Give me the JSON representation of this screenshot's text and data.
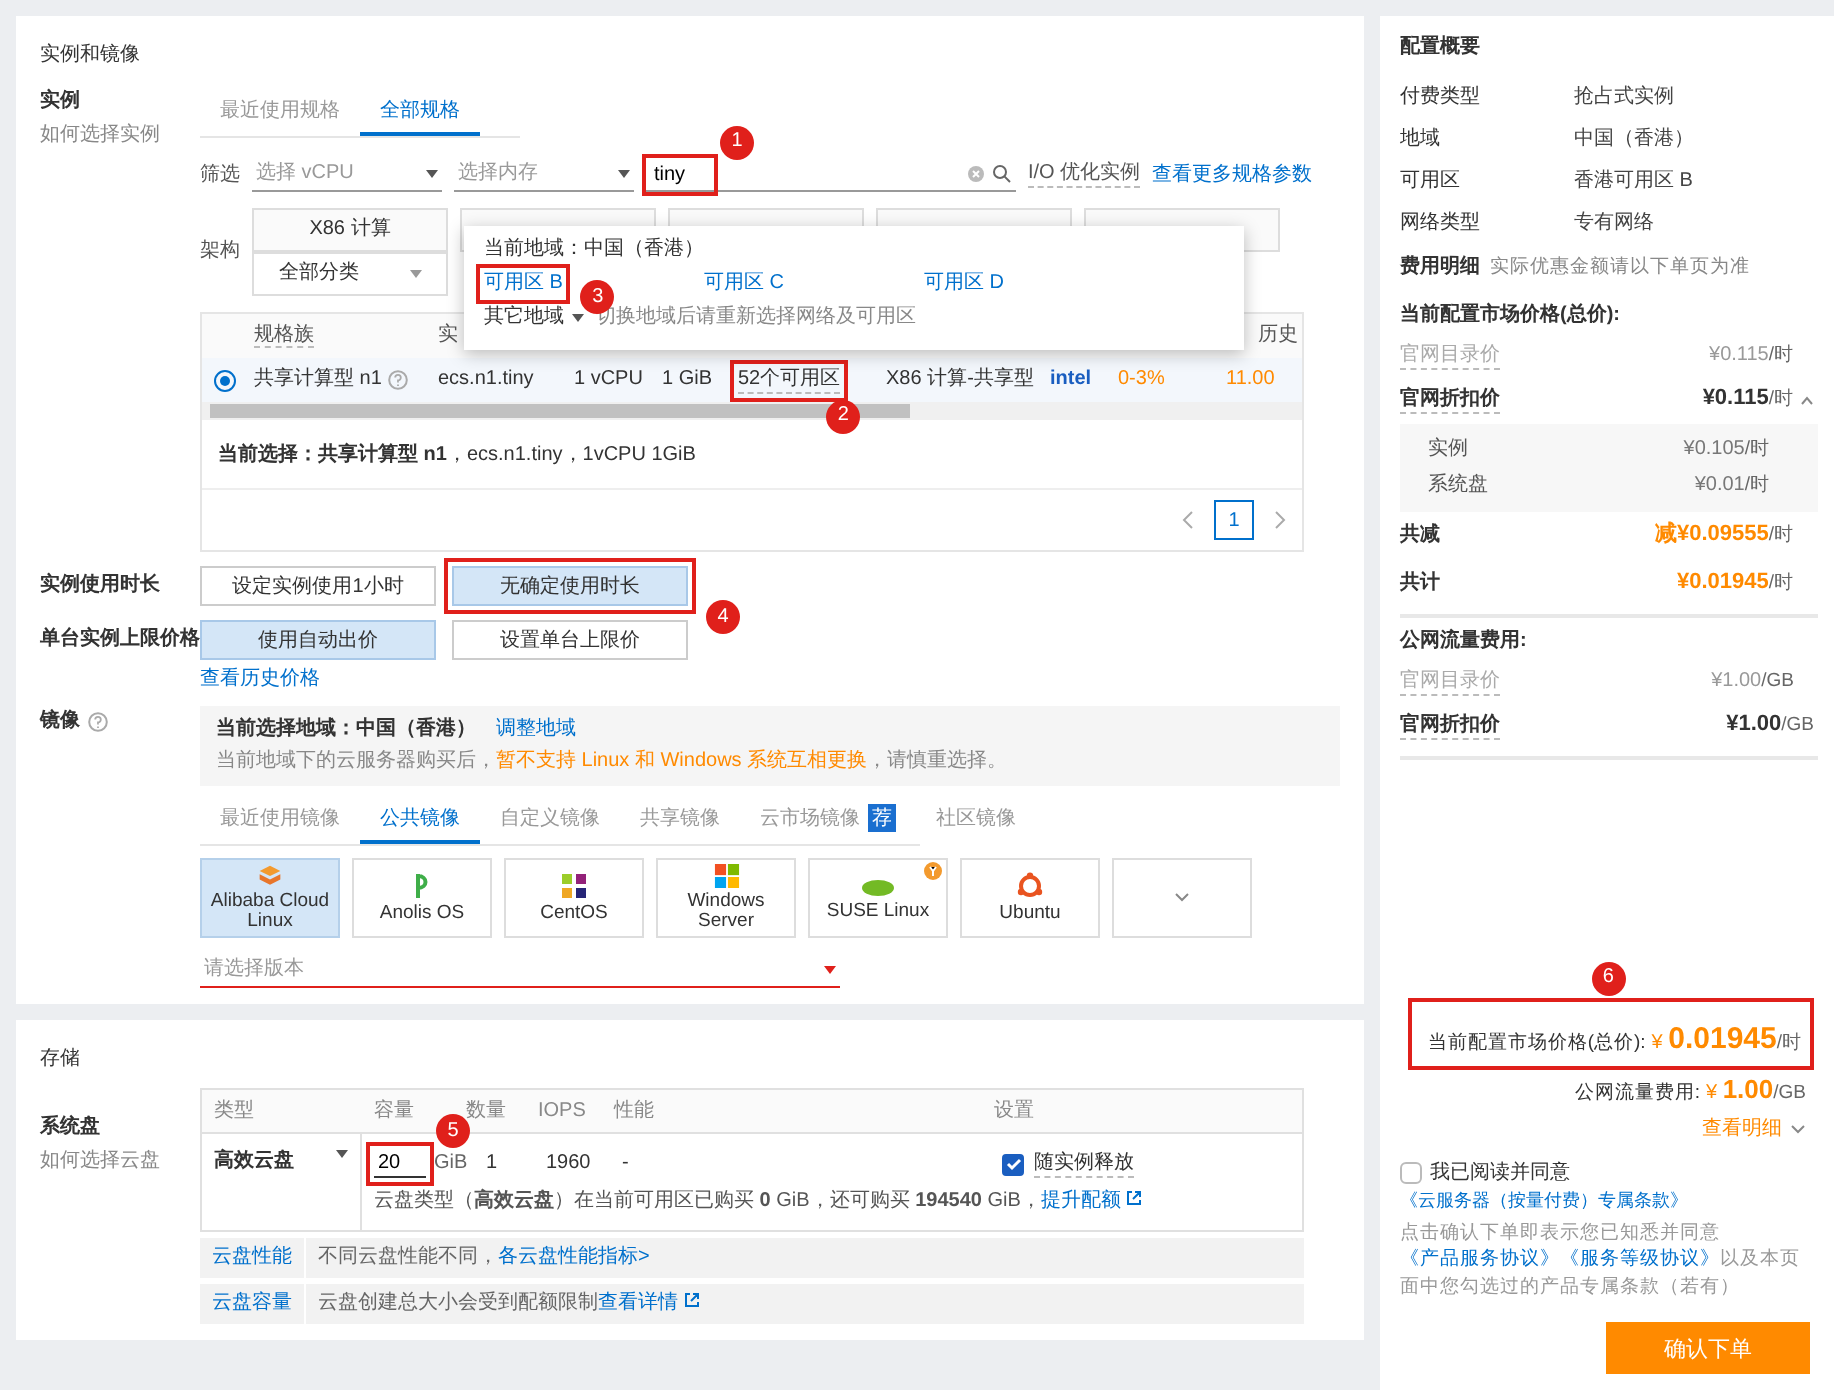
{
  "instance_section": {
    "title": "实例和镜像",
    "instance": {
      "label": "实例",
      "help": "如何选择实例",
      "tabs": [
        {
          "label": "最近使用规格",
          "selected": false
        },
        {
          "label": "全部规格",
          "selected": true
        }
      ],
      "filter": {
        "label": "筛选",
        "vcpu_placeholder": "选择 vCPU",
        "memory_placeholder": "选择内存",
        "search_value": "tiny",
        "search_marker": "1",
        "io_label": "I/O 优化实例",
        "more_link": "查看更多规格参数"
      },
      "arch": {
        "label": "架构",
        "first_tile": "X86 计算",
        "category": "全部分类"
      },
      "zone_popup": {
        "current": "当前地域：中国（香港）",
        "zones": [
          {
            "label": "可用区 B",
            "marker": "3"
          },
          {
            "label": "可用区 C"
          },
          {
            "label": "可用区 D"
          }
        ],
        "other": "其它地域",
        "other_hint": "切换地域后请重新选择网络及可用区"
      },
      "table": {
        "columns": [
          {
            "label": "规格族"
          },
          {
            "label": "实"
          },
          {
            "label": "历史"
          }
        ],
        "rows": [
          {
            "selected": true,
            "family": "共享计算型 n1",
            "spec": "ecs.n1.tiny",
            "vcpu": "1 vCPU",
            "memory": "1 GiB",
            "zones": "52个可用区",
            "zones_marker": "2",
            "arch": "X86 计算-共享型",
            "brand": "intel",
            "performance": "0-3%",
            "price": "11.00"
          }
        ]
      },
      "current_selection": "**当前选择：共享计算型 n1**，ecs.n1.tiny，1vCPU 1GiB",
      "pagination": {
        "page": "1"
      }
    },
    "duration": {
      "label": "实例使用时长",
      "options": [
        {
          "label": "设定实例使用1小时",
          "selected": false
        },
        {
          "label": "无确定使用时长",
          "selected": true,
          "marker": "4"
        }
      ]
    },
    "price_limit": {
      "label": "单台实例上限价格",
      "options": [
        {
          "label": "使用自动出价",
          "selected": true
        },
        {
          "label": "设置单台上限价",
          "selected": false
        }
      ],
      "history_link": "查看历史价格"
    },
    "image": {
      "label": "镜像",
      "region_text": "当前选择地域：中国（香港）",
      "adjust_link": "调整地域",
      "notice": "当前地域下的云服务器购买后，",
      "notice_warn": "暂不支持 Linux 和 Windows 系统互相更换",
      "notice_end": "，请慎重选择。",
      "tabs": [
        {
          "label": "最近使用镜像",
          "selected": false
        },
        {
          "label": "公共镜像",
          "selected": true
        },
        {
          "label": "自定义镜像",
          "selected": false
        },
        {
          "label": "共享镜像",
          "selected": false
        },
        {
          "label": "云市场镜像",
          "selected": false,
          "badge": "荐"
        },
        {
          "label": "社区镜像",
          "selected": false
        }
      ],
      "os": [
        {
          "kind": "alibaba",
          "label": "Alibaba Cloud Linux",
          "selected": true
        },
        {
          "kind": "anolis",
          "label": "Anolis OS",
          "selected": false
        },
        {
          "kind": "centos",
          "label": "CentOS",
          "selected": false
        },
        {
          "kind": "windows",
          "label": "Windows Server",
          "selected": false
        },
        {
          "kind": "suse",
          "label": "SUSE Linux",
          "selected": false
        },
        {
          "kind": "ubuntu",
          "label": "Ubuntu",
          "selected": false
        },
        {
          "kind": "more",
          "selected": false
        }
      ],
      "version_placeholder": "请选择版本"
    }
  },
  "storage": {
    "title": "存储",
    "label": "系统盘",
    "help": "如何选择云盘",
    "columns": [
      "类型",
      "容量",
      "数量",
      "IOPS",
      "性能",
      "设置"
    ],
    "disk": {
      "type": "高效云盘",
      "capacity": "20",
      "capacity_marker": "5",
      "unit": "GiB",
      "count": "1",
      "iops": "1960",
      "performance": "-",
      "release_checked": true,
      "release_label": "随实例释放",
      "quota_note": "云盘类型（**高效云盘**）在当前可用区已购买 **0** GiB，还可购买 **194540** GiB，",
      "quota_link": "提升配额"
    },
    "tips": [
      {
        "tag": "云盘性能",
        "text": "不同云盘性能不同，",
        "link": "各云盘性能指标>"
      },
      {
        "tag": "云盘容量",
        "text": "云盘创建总大小会受到配额限制",
        "link": "查看详情"
      }
    ]
  },
  "summary": {
    "title": "配置概要",
    "rows": [
      {
        "label": "付费类型",
        "value": "抢占式实例"
      },
      {
        "label": "地域",
        "value": "中国（香港）"
      },
      {
        "label": "可用区",
        "value": "香港可用区 B"
      },
      {
        "label": "网络类型",
        "value": "专有网络"
      }
    ],
    "fees": {
      "title": "费用明细",
      "hint": "实际优惠金额请以下单页为准",
      "groups": [
        {
          "title": "当前配置市场价格(总价):",
          "lines": [
            {
              "kind": "muted",
              "label": "官网目录价",
              "price": "¥0.115",
              "unit": "/时"
            },
            {
              "kind": "strong",
              "label": "官网折扣价",
              "price": "¥0.115",
              "unit": "/时",
              "expanded": true,
              "children": [
                {
                  "label": "实例",
                  "price": "¥0.105",
                  "unit": "/时"
                },
                {
                  "label": "系统盘",
                  "price": "¥0.01",
                  "unit": "/时"
                }
              ]
            },
            {
              "kind": "accent",
              "label": "共减",
              "price": "减¥0.09555",
              "unit": "/时"
            },
            {
              "kind": "accent",
              "label": "共计",
              "price": "¥0.01945",
              "unit": "/时"
            }
          ]
        },
        {
          "title": "公网流量费用:",
          "lines": [
            {
              "kind": "muted",
              "label": "官网目录价",
              "price": "¥1.00",
              "unit": "/GB"
            },
            {
              "kind": "strong",
              "label": "官网折扣价",
              "price": "¥1.00",
              "unit": "/GB"
            }
          ]
        }
      ]
    },
    "footer": {
      "market_label": "当前配置市场价格(总价):",
      "currency": "¥",
      "market_price": "0.01945",
      "market_unit": "/时",
      "marker": "6",
      "traffic_label": "公网流量费用:",
      "traffic_currency": "¥",
      "traffic_price": "1.00",
      "traffic_unit": "/GB",
      "details_link": "查看明细",
      "agree_checked": false,
      "agree_text": "我已阅读并同意",
      "agree_link": "《云服务器（按量付费）专属条款》",
      "terms": [
        {
          "kind": "text",
          "text": "点击确认下单即表示您已知悉并同意"
        },
        {
          "kind": "link",
          "text": "《产品服务协议》"
        },
        {
          "kind": "link",
          "text": "《服务等级协议》"
        },
        {
          "kind": "text",
          "text": "以及本页面中您勾选过的产品专属条款（若有）"
        }
      ],
      "confirm": "确认下单"
    }
  }
}
